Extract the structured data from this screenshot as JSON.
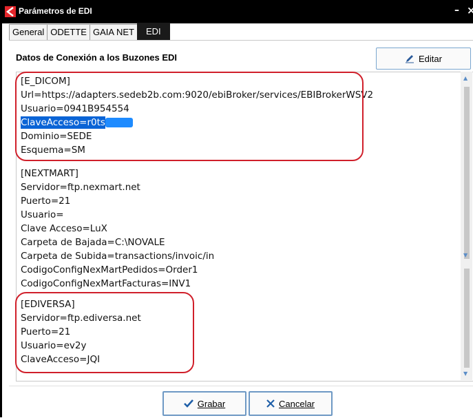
{
  "window": {
    "title": "Parámetros de EDI",
    "minimize_glyph": "–",
    "close_glyph": "×"
  },
  "tabs": [
    {
      "label": "General",
      "active": false
    },
    {
      "label": "ODETTE",
      "active": false
    },
    {
      "label": "GAIA NET",
      "active": false
    },
    {
      "label": "EDI",
      "active": true
    }
  ],
  "section_title": "Datos de Conexión a los Buzones EDI",
  "edit_button": {
    "label": "Editar",
    "icon": "pencil-icon"
  },
  "config_text": {
    "edicom": {
      "header": "[E_DICOM]",
      "url": "Url=https://adapters.sedeb2b.com:9020/ebiBroker/services/EBIBrokerWSV2",
      "usuario": "Usuario=0941B954554",
      "clave": "ClaveAcceso=r0ts",
      "dominio": "Dominio=SEDE",
      "esquema": "Esquema=SM"
    },
    "nextmart": {
      "header": "[NEXTMART]",
      "servidor": "Servidor=ftp.nexmart.net",
      "puerto": "Puerto=21",
      "usuario": "Usuario=",
      "clave": "Clave Acceso=LuX",
      "carpeta_bajada": "Carpeta de Bajada=C:\\NOVALE",
      "carpeta_subida": "Carpeta de Subida=transactions/invoic/in",
      "pedidos": "CodigoConfigNexMartPedidos=Order1",
      "facturas": "CodigoConfigNexMartFacturas=INV1"
    },
    "ediversa": {
      "header": "[EDIVERSA]",
      "servidor": "Servidor=ftp.ediversa.net",
      "puerto": "Puerto=21",
      "usuario": "Usuario=ev2y",
      "clave": "ClaveAcceso=JQI"
    }
  },
  "footer": {
    "save_label": "Grabar",
    "cancel_label": "Cancelar",
    "save_icon": "check-icon",
    "cancel_icon": "x-icon"
  },
  "colors": {
    "titlebar": "#000000",
    "selection": "#0a64d6",
    "highlight_box": "#d01f2a",
    "button_border": "#6d98c4",
    "logo_red": "#e5262b"
  }
}
